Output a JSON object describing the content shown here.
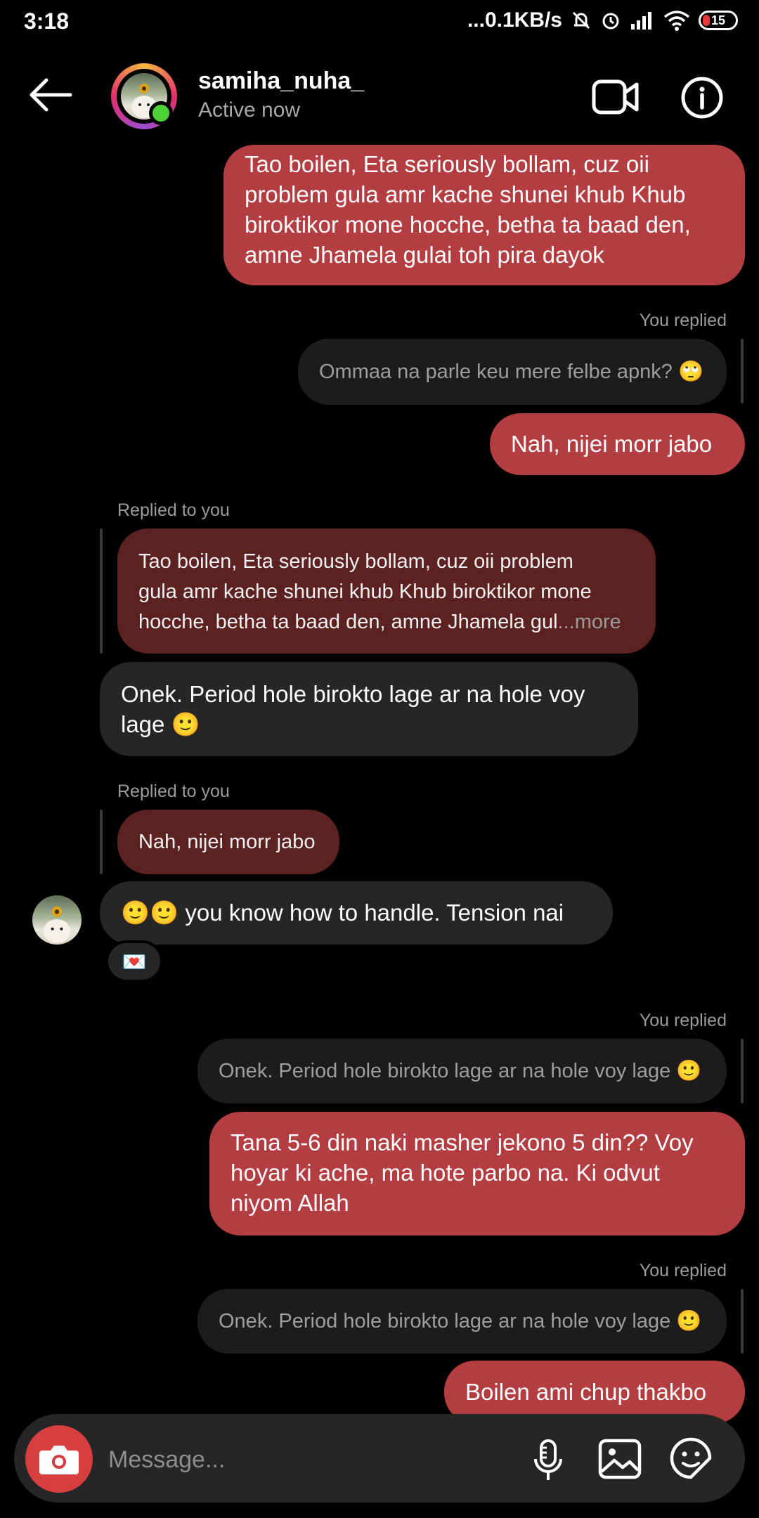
{
  "status_bar": {
    "time": "3:18",
    "net_speed": "...0.1KB/s",
    "battery": "15"
  },
  "header": {
    "username": "samiha_nuha_",
    "status": "Active now"
  },
  "messages": {
    "m1": {
      "lines": [
        "Tao boilen, Eta seriously bollam, cuz oii",
        "problem gula amr kache shunei khub Khub",
        "biroktikor mone hocche, betha ta baad den,",
        "amne Jhamela gulai toh pira dayok"
      ]
    },
    "label1": "You replied",
    "q1": "Ommaa na parle keu mere felbe apnk? 🙄",
    "m2": "Nah, nijei morr jabo",
    "label2": "Replied to you",
    "q2": {
      "lines": [
        "Tao boilen, Eta seriously bollam, cuz oii problem",
        "gula amr kache shunei khub Khub biroktikor mone",
        "hocche, betha ta baad den, amne Jhamela gul"
      ],
      "more": "...more"
    },
    "m3": {
      "lines": [
        "Onek. Period hole birokto lage ar na hole voy",
        "lage 🙂"
      ]
    },
    "label3": "Replied to you",
    "q3": "Nah, nijei morr jabo",
    "m4": "🙂🙂 you know how to handle. Tension nai",
    "reaction": "💌",
    "label4": "You replied",
    "q4": "Onek. Period hole birokto lage ar na hole voy lage 🙂",
    "m5": {
      "lines": [
        "Tana 5-6 din naki masher jekono 5 din?? Voy",
        "hoyar ki ache, ma hote parbo na. Ki odvut",
        "niyom Allah"
      ]
    },
    "label5": "You replied",
    "q5": "Onek. Period hole birokto lage ar na hole voy lage 🙂",
    "m6": "Boilen ami chup thakbo"
  },
  "composer": {
    "placeholder": "Message..."
  },
  "colors": {
    "outgoing": "#b43d41",
    "incoming": "#262626",
    "online": "#4cd137",
    "camera": "#d63e40"
  },
  "icons": [
    "back-arrow-icon",
    "video-call-icon",
    "info-icon",
    "camera-icon",
    "mic-icon",
    "gallery-icon",
    "sticker-icon"
  ]
}
